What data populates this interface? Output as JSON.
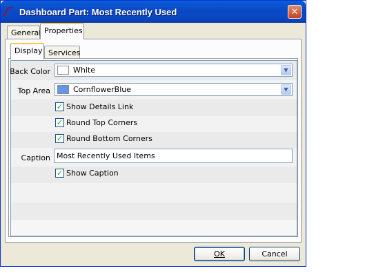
{
  "window": {
    "title": "Dashboard Part: Most Recently Used",
    "close_icon": "close-icon"
  },
  "tabs": [
    {
      "label": "General",
      "active": false
    },
    {
      "label": "Properties",
      "active": true
    }
  ],
  "subtabs": [
    {
      "label": "Display",
      "active": true
    },
    {
      "label": "Services",
      "active": false
    }
  ],
  "form": {
    "back_color": {
      "label": "Back Color",
      "value": "White",
      "swatch": "#ffffff"
    },
    "top_area": {
      "label": "Top Area",
      "value": "CornflowerBlue",
      "swatch": "#6495ed"
    },
    "show_details_link": {
      "label": "Show Details Link",
      "checked": true
    },
    "round_top_corners": {
      "label": "Round Top Corners",
      "checked": true
    },
    "round_bottom_corners": {
      "label": "Round Bottom Corners",
      "checked": true
    },
    "caption": {
      "label": "Caption",
      "value": "Most Recently Used Items"
    },
    "show_caption": {
      "label": "Show Caption",
      "checked": true
    }
  },
  "buttons": {
    "ok": "OK",
    "cancel": "Cancel"
  }
}
